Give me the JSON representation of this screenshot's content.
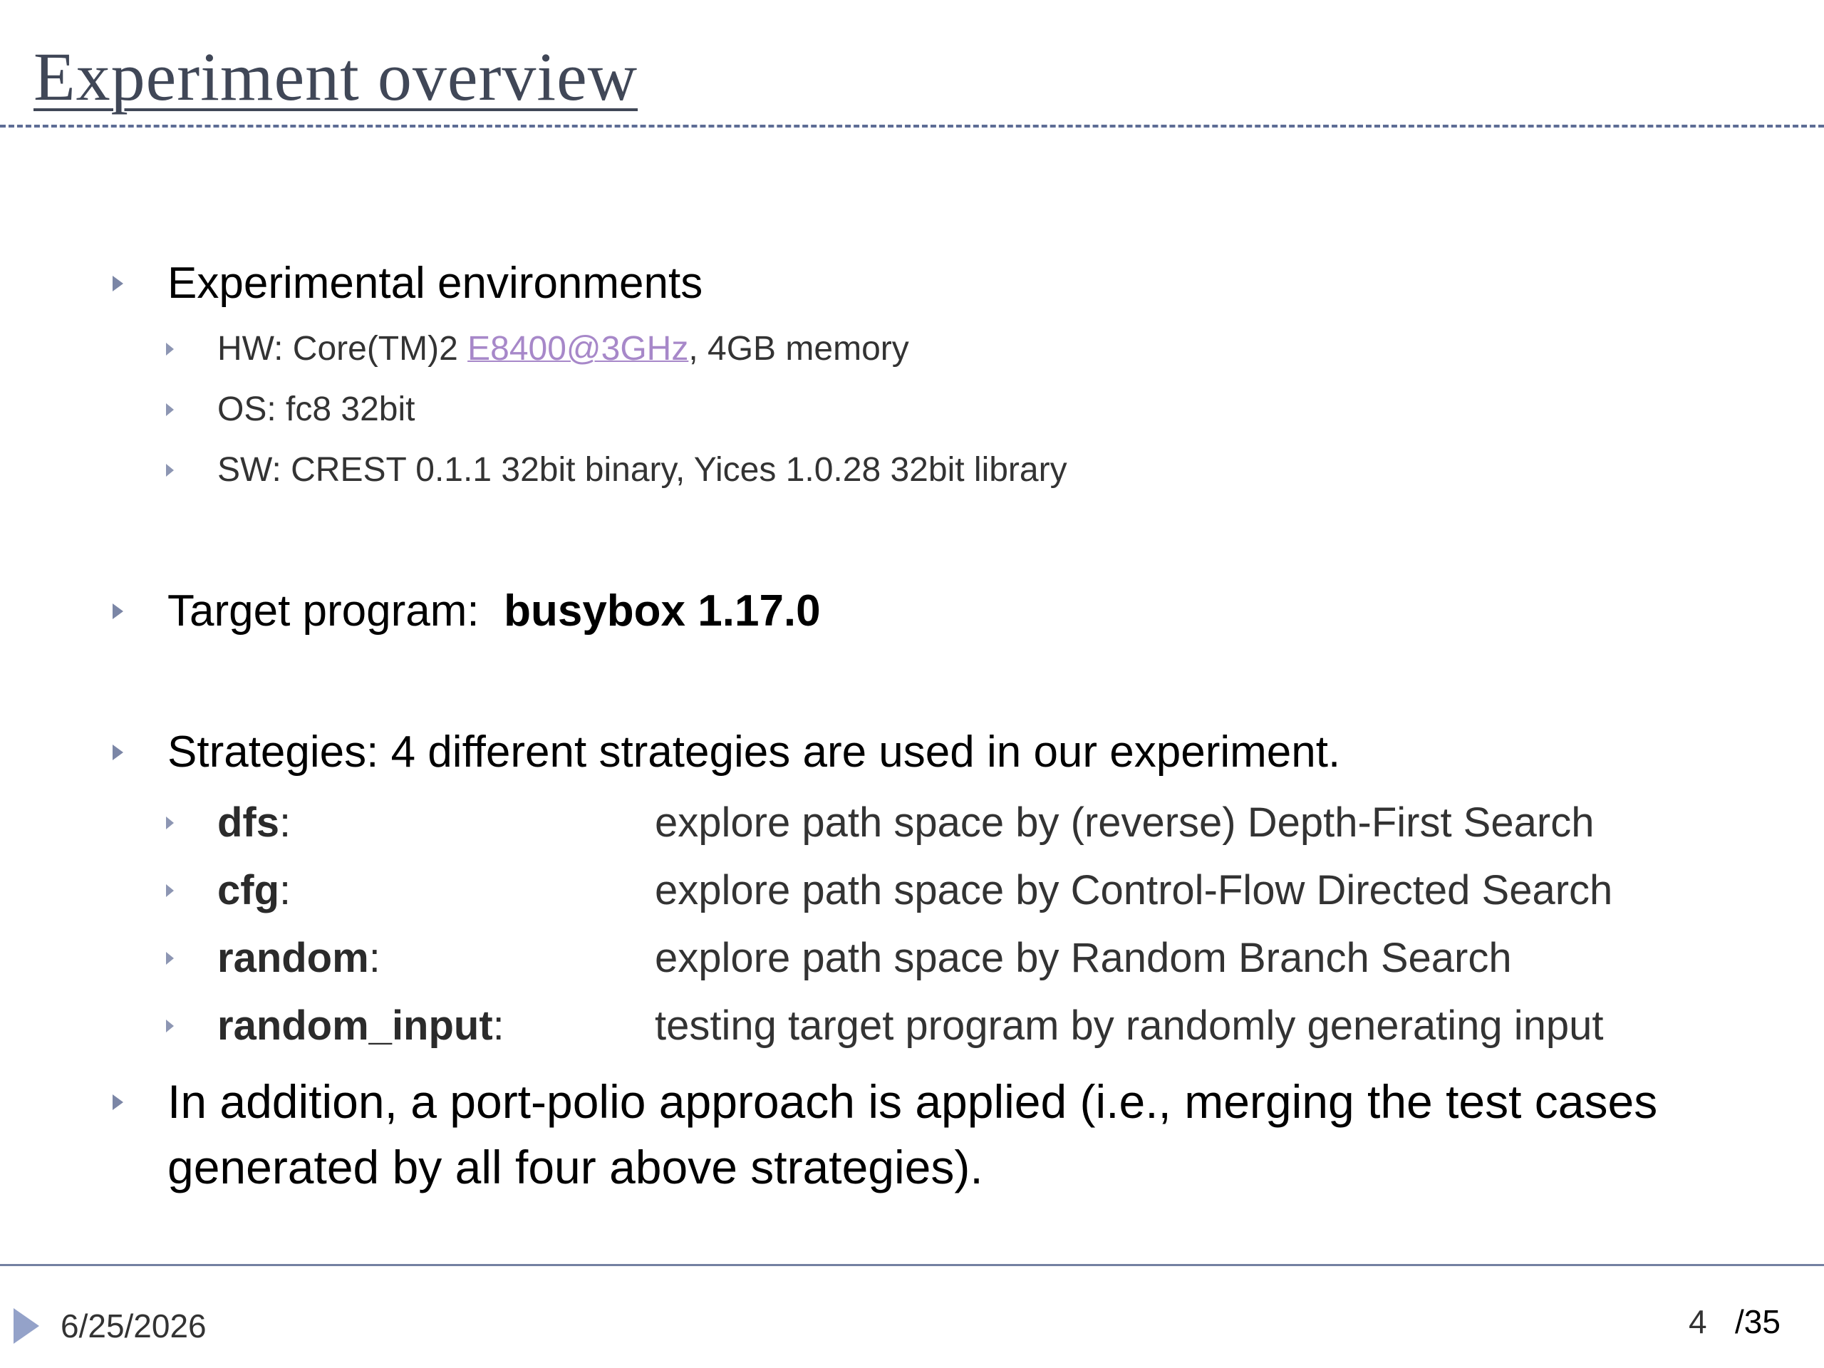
{
  "slide": {
    "title": "Experiment overview",
    "sections": {
      "environments": {
        "heading": "Experimental environments",
        "hw": {
          "prefix": "HW: Core(TM)2 ",
          "link": "E8400@3GHz",
          "suffix": ", 4GB memory"
        },
        "os": "OS: fc8 32bit",
        "sw": "SW: CREST 0.1.1 32bit binary, Yices 1.0.28 32bit library"
      },
      "target": {
        "label": "Target program:  ",
        "value": "busybox 1.17.0"
      },
      "strategies": {
        "heading": "Strategies: 4 different strategies are used in our experiment.",
        "items": [
          {
            "name": "dfs",
            "colon": ":",
            "description": "explore path space by (reverse) Depth-First Search"
          },
          {
            "name": "cfg",
            "colon": ":",
            "description": "explore path space by Control-Flow Directed Search"
          },
          {
            "name": "random",
            "colon": ":",
            "description": "explore path space by Random Branch Search"
          },
          {
            "name": "random_input",
            "colon": ":",
            "description": "testing target program by randomly generating input"
          }
        ]
      },
      "addition": "In addition, a port-polio approach is applied (i.e., merging the test cases generated by all four above strategies)."
    }
  },
  "footer": {
    "date": "6/25/2026",
    "page": "4",
    "total": "/35"
  },
  "colors": {
    "title": "#404757",
    "accent": "#7b86a6",
    "link": "#a788c9",
    "rule": "#7380a2"
  },
  "icons": {
    "bullet": "triangle-right-icon",
    "footer": "triangle-right-icon"
  }
}
